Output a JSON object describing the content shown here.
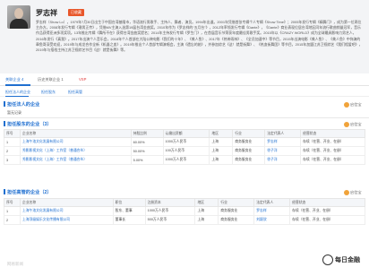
{
  "profile": {
    "name": "罗志祥",
    "fav_button": "已收藏",
    "bio": "罗志祥（Show Lo），1979年7月30日出生于中国台湾基隆市，华语流行男歌手、主持人、舞者、演员。1994年出道。2001年凭借首张专辑个人专辑《Show Time》；2005年发行专辑《精舞门》，成为第一位两位主办方。2008年发行专辑《潮男正传》，凭借MV主演入选第19届台湾金曲奖。2010年作为《罗志祥的“五月台”》，2012年率领发行专辑《Dante》，《Dante》商业表现位居台湾地区同年流行歌曲销量冠军，音乐作品获得亚洲多项奖项。13年推出专辑《舞所不在》获得台湾金曲奖提名；2014年主持发行专辑《罗生门》，在首届音乐节荣获年度最佳男歌手奖。2015年以《CRAZY WORLD》成为全球最具影响力男艺人，2016年发行《真我》。2017年出演个人音乐会，2018年个人首部在大陆公映电影《我们的十年》、《美人鱼》、2017年《热带雨林》、《全员加速中》等节目，2015年出演电影《美人鱼》、《美人鱼》中饰演的章鱼哥深受欢迎，2019年与成龙合作全新《机器之血》。2019年推出个人首部专辑演唱会，主演《遗忘的她》，并参加综艺《这！就是街舞》、《热血街舞团》等节目，2015年加盟江苏卫视综艺《我们相爱吧》，2019年与搭档主持江苏卫视综艺节目《这！就是街舞》等。"
  },
  "tabs": [
    {
      "label": "关联企业",
      "count": "4"
    },
    {
      "label": "历史关联企业",
      "count": "1"
    },
    {
      "label": "VSP",
      "count": ""
    }
  ],
  "subtabs": [
    "担任法人的企业",
    "担任股东",
    "担任高管"
  ],
  "sections": {
    "legal": {
      "title": "担任法人的企业",
      "brand": "启信宝",
      "empty": "暂无记录"
    },
    "shareholder": {
      "title": "担任股东的企业（3）",
      "brand": "启信宝",
      "headers": [
        "序号",
        "企业名称",
        "持股比例",
        "认缴出资额",
        "地区",
        "行业",
        "法定代表人",
        "经营状态"
      ],
      "rows": [
        [
          "1",
          "上海午洛文化发展有限公司",
          "60.00%",
          "1000万人民币",
          "上海",
          "商务服务业",
          "罗志祥",
          "存续（在营、开业、在册）"
        ],
        [
          "2",
          "秀影影视文化（上海）工作室（普通合伙）",
          "50.00%",
          "100万人民币",
          "上海",
          "商务服务业",
          "徐子洋",
          "存续（在营、开业、在册）"
        ],
        [
          "3",
          "秀影影视文化（上海）工作室（普通合伙）",
          "5.00%",
          "1000万人民币",
          "上海",
          "商务服务业",
          "徐子洋",
          "存续（在营、开业、在册）"
        ]
      ]
    },
    "executive": {
      "title": "担任高管的企业（2）",
      "brand": "启信宝",
      "headers": [
        "序号",
        "企业名称",
        "职位",
        "注册资本",
        "地区",
        "行业",
        "法定代表人",
        "经营状态"
      ],
      "rows": [
        [
          "1",
          "上海午洛文化发展有限公司",
          "股东、董事",
          "1000万人民币",
          "上海",
          "商务服务业",
          "罗志祥",
          "存续（在营、开业、在册）"
        ],
        [
          "2",
          "上海顶级娱乐文化传播有限公司",
          "董事长",
          "500万人民币",
          "上海",
          "商务服务业",
          "刘颖欣",
          "存续（在营、开业、在册）"
        ]
      ]
    }
  },
  "footer": {
    "watermark": "网易新闻",
    "logo_text": "每日金融"
  }
}
